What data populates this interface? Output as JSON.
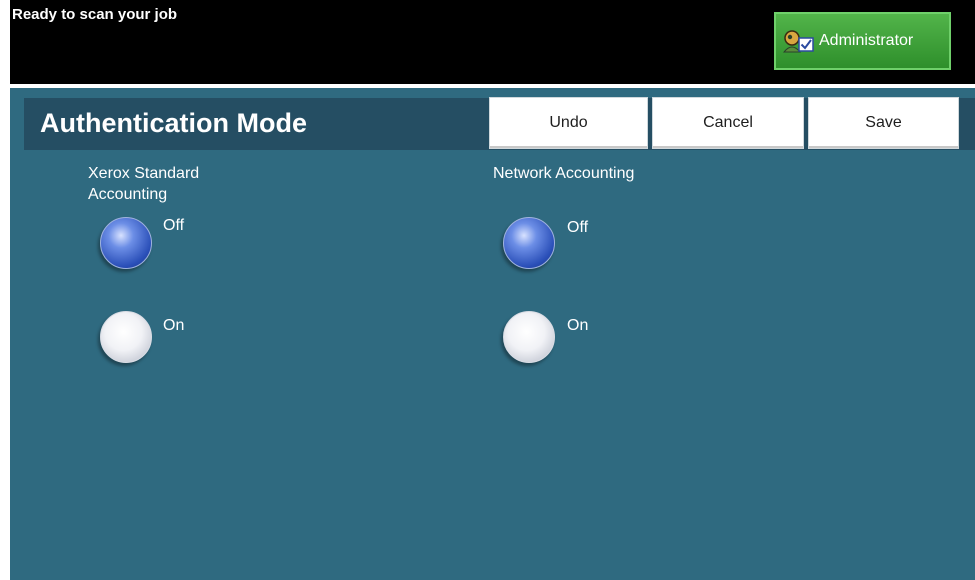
{
  "status": {
    "message": "Ready to scan your job"
  },
  "admin": {
    "label": "Administrator",
    "icon": "administrator-icon"
  },
  "header": {
    "title": "Authentication Mode"
  },
  "actions": {
    "undo": "Undo",
    "cancel": "Cancel",
    "save": "Save"
  },
  "groups": [
    {
      "label": "Xerox Standard Accounting",
      "options": [
        {
          "label": "Off",
          "selected": true
        },
        {
          "label": "On",
          "selected": false
        }
      ]
    },
    {
      "label": "Network Accounting",
      "options": [
        {
          "label": "Off",
          "selected": true
        },
        {
          "label": "On",
          "selected": false
        }
      ]
    }
  ],
  "colors": {
    "background": "#2f6a80",
    "title_bar": "#254e63",
    "status_bar": "#000000",
    "admin_button": "#3ea23a"
  }
}
